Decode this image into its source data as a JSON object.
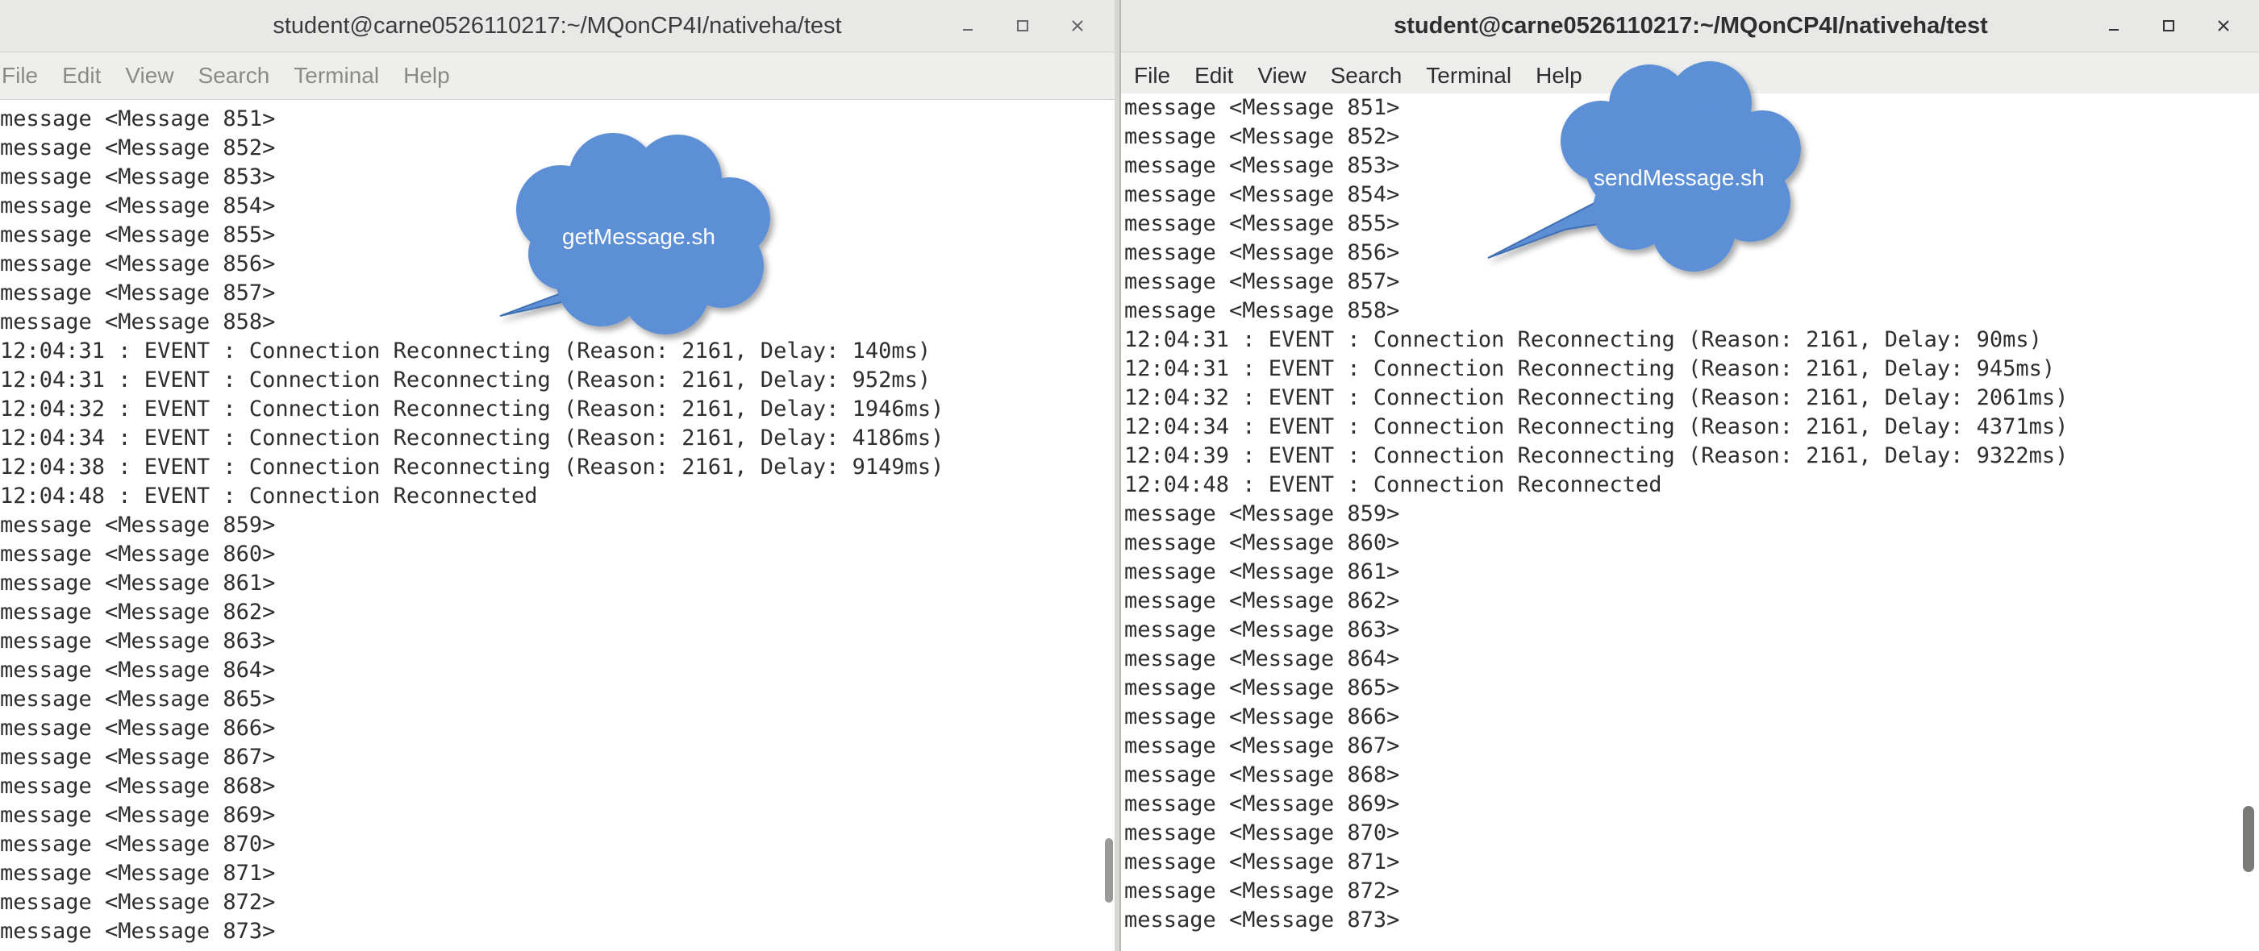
{
  "left_window": {
    "title": "student@carne0526110217:~/MQonCP4I/nativeha/test",
    "menu": [
      "File",
      "Edit",
      "View",
      "Search",
      "Terminal",
      "Help"
    ],
    "lines": [
      "message <Message 851>",
      "message <Message 852>",
      "message <Message 853>",
      "message <Message 854>",
      "message <Message 855>",
      "message <Message 856>",
      "message <Message 857>",
      "message <Message 858>",
      "12:04:31 : EVENT : Connection Reconnecting (Reason: 2161, Delay: 140ms)",
      "12:04:31 : EVENT : Connection Reconnecting (Reason: 2161, Delay: 952ms)",
      "12:04:32 : EVENT : Connection Reconnecting (Reason: 2161, Delay: 1946ms)",
      "12:04:34 : EVENT : Connection Reconnecting (Reason: 2161, Delay: 4186ms)",
      "12:04:38 : EVENT : Connection Reconnecting (Reason: 2161, Delay: 9149ms)",
      "12:04:48 : EVENT : Connection Reconnected",
      "message <Message 859>",
      "message <Message 860>",
      "message <Message 861>",
      "message <Message 862>",
      "message <Message 863>",
      "message <Message 864>",
      "message <Message 865>",
      "message <Message 866>",
      "message <Message 867>",
      "message <Message 868>",
      "message <Message 869>",
      "message <Message 870>",
      "message <Message 871>",
      "message <Message 872>",
      "message <Message 873>"
    ],
    "callout": "getMessage.sh"
  },
  "right_window": {
    "title": "student@carne0526110217:~/MQonCP4I/nativeha/test",
    "menu": [
      "File",
      "Edit",
      "View",
      "Search",
      "Terminal",
      "Help"
    ],
    "lines": [
      "message <Message 851>",
      "message <Message 852>",
      "message <Message 853>",
      "message <Message 854>",
      "message <Message 855>",
      "message <Message 856>",
      "message <Message 857>",
      "message <Message 858>",
      "12:04:31 : EVENT : Connection Reconnecting (Reason: 2161, Delay: 90ms)",
      "12:04:31 : EVENT : Connection Reconnecting (Reason: 2161, Delay: 945ms)",
      "12:04:32 : EVENT : Connection Reconnecting (Reason: 2161, Delay: 2061ms)",
      "12:04:34 : EVENT : Connection Reconnecting (Reason: 2161, Delay: 4371ms)",
      "12:04:39 : EVENT : Connection Reconnecting (Reason: 2161, Delay: 9322ms)",
      "12:04:48 : EVENT : Connection Reconnected",
      "message <Message 859>",
      "message <Message 860>",
      "message <Message 861>",
      "message <Message 862>",
      "message <Message 863>",
      "message <Message 864>",
      "message <Message 865>",
      "message <Message 866>",
      "message <Message 867>",
      "message <Message 868>",
      "message <Message 869>",
      "message <Message 870>",
      "message <Message 871>",
      "message <Message 872>",
      "message <Message 873>"
    ],
    "callout": "sendMessage.sh"
  },
  "icons": {
    "minimize": "minimize-icon",
    "maximize": "maximize-icon",
    "close": "close-icon"
  },
  "colors": {
    "callout_fill": "#5b8fd6",
    "callout_stroke": "#3f6fb3",
    "titlebar": "#e8e8e7",
    "menubar": "#eeeeec",
    "terminal_bg": "#ffffff",
    "terminal_text": "#2e2e2e"
  }
}
